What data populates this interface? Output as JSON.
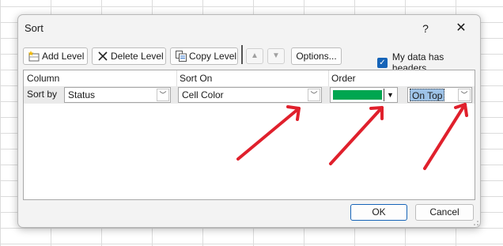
{
  "dialog": {
    "title": "Sort",
    "help_label": "?",
    "close_label": "✕"
  },
  "toolbar": {
    "add_level": "Add Level",
    "delete_level": "Delete Level",
    "copy_level": "Copy Level",
    "move_up": "▲",
    "move_down": "▼",
    "options": "Options...",
    "has_headers_label": "My data has headers",
    "has_headers_checked": true
  },
  "grid": {
    "headers": {
      "column": "Column",
      "sort_on": "Sort On",
      "order": "Order"
    },
    "row": {
      "label": "Sort by",
      "column_value": "Status",
      "sort_on_value": "Cell Color",
      "order_color": "#00a650",
      "order_position": "On Top"
    }
  },
  "footer": {
    "ok": "OK",
    "cancel": "Cancel"
  },
  "annotation": {
    "arrow_color": "#e0202c"
  }
}
